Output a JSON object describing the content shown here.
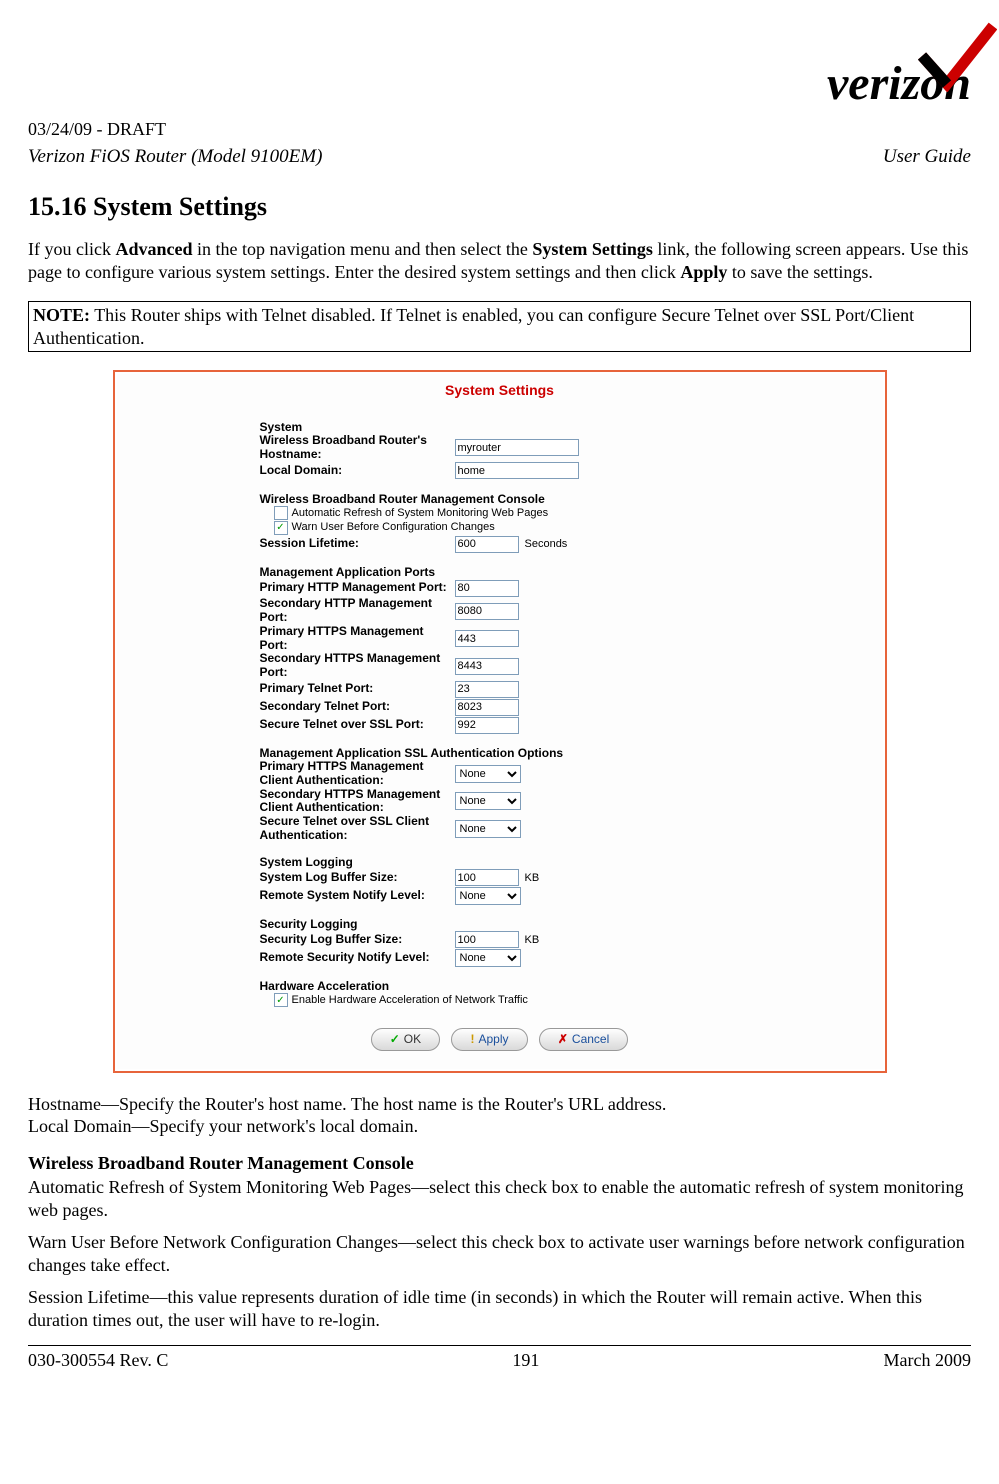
{
  "header": {
    "logo_text": "verizon",
    "draft_line": "03/24/09 - DRAFT",
    "model": "Verizon FiOS Router (Model 9100EM)",
    "guide": "User Guide"
  },
  "section": {
    "number_title": "15.16   System Settings",
    "intro_prefix": "If you click ",
    "intro_bold1": "Advanced",
    "intro_mid1": " in the top navigation menu and then select the ",
    "intro_bold2": "System Settings",
    "intro_mid2": " link, the following screen appears. Use this page to configure various system settings. Enter the desired system settings and then click ",
    "intro_bold3": "Apply",
    "intro_suffix": " to save the settings."
  },
  "note": {
    "label": "NOTE:",
    "text": " This Router ships with Telnet disabled. If Telnet is enabled, you can configure Secure Telnet over SSL Port/Client Authentication."
  },
  "panel": {
    "title": "System Settings",
    "system": {
      "head": "System",
      "hostname_label": "Wireless Broadband Router's Hostname:",
      "hostname_value": "myrouter",
      "localdomain_label": "Local Domain:",
      "localdomain_value": "home"
    },
    "mgmt_console": {
      "head": "Wireless Broadband Router Management Console",
      "auto_refresh": "Automatic Refresh of System Monitoring Web Pages",
      "warn_user": "Warn User Before Configuration Changes",
      "session_label": "Session Lifetime:",
      "session_value": "600",
      "session_unit": "Seconds"
    },
    "ports": {
      "head": "Management Application Ports",
      "p_http_label": "Primary HTTP Management Port:",
      "p_http_value": "80",
      "s_http_label": "Secondary HTTP Management Port:",
      "s_http_value": "8080",
      "p_https_label": "Primary HTTPS Management Port:",
      "p_https_value": "443",
      "s_https_label": "Secondary HTTPS Management Port:",
      "s_https_value": "8443",
      "p_telnet_label": "Primary Telnet Port:",
      "p_telnet_value": "23",
      "s_telnet_label": "Secondary Telnet Port:",
      "s_telnet_value": "8023",
      "ssl_telnet_label": "Secure Telnet over SSL Port:",
      "ssl_telnet_value": "992"
    },
    "ssl_auth": {
      "head": "Management Application SSL Authentication Options",
      "p_https_label": "Primary HTTPS Management Client Authentication:",
      "p_https_value": "None",
      "s_https_label": "Secondary HTTPS Management Client Authentication:",
      "s_https_value": "None",
      "telnet_ssl_label": "Secure Telnet over SSL Client Authentication:",
      "telnet_ssl_value": "None"
    },
    "syslog": {
      "head": "System Logging",
      "buf_label": "System Log Buffer Size:",
      "buf_value": "100",
      "buf_unit": "KB",
      "notify_label": "Remote System Notify Level:",
      "notify_value": "None"
    },
    "seclog": {
      "head": "Security Logging",
      "buf_label": "Security Log Buffer Size:",
      "buf_value": "100",
      "buf_unit": "KB",
      "notify_label": "Remote Security Notify Level:",
      "notify_value": "None"
    },
    "hw": {
      "head": "Hardware Acceleration",
      "enable": "Enable Hardware Acceleration of Network Traffic"
    },
    "buttons": {
      "ok": "OK",
      "apply": "Apply",
      "cancel": "Cancel"
    }
  },
  "desc": {
    "hostname_term": "Hostname—",
    "hostname_text": "Specify the Router's host name. The host name is the Router's URL address.",
    "localdomain_text": "Local Domain—Specify your network's local domain.",
    "subhead": "Wireless Broadband Router Management Console",
    "auto_term": "Automatic Refresh of System Monitoring Web Pages—",
    "auto_text": "select this check box to enable the automatic refresh of system monitoring web pages.",
    "warn_term": "Warn User Before Network Configuration Changes—",
    "warn_text": "select this check box to activate user warnings before network configuration changes take effect.",
    "session_term": "Session Lifetime—",
    "session_text": "this value represents duration of idle time (in seconds) in which the Router will remain active. When this duration times out, the user will have to re-login."
  },
  "footer": {
    "left": "030-300554 Rev. C",
    "center": "191",
    "right": "March 2009"
  }
}
